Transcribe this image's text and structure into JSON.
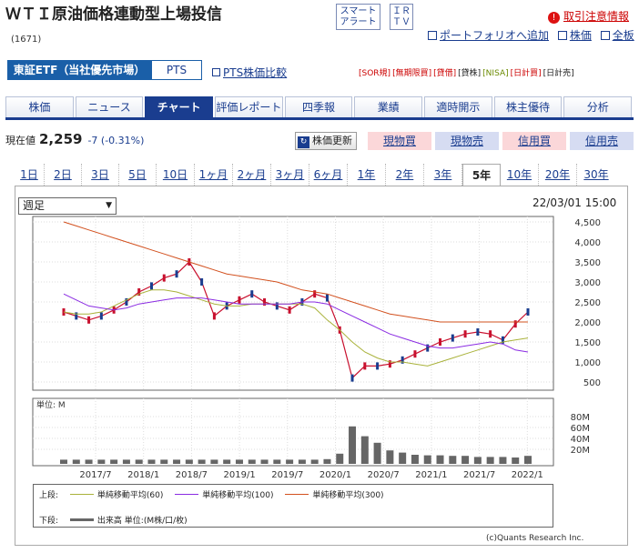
{
  "header": {
    "title": "ＷＴＩ原油価格連動型上場投信",
    "code": "(1671)",
    "smart_alert": "スマート アラート",
    "irtv": "ＩＲ ＴＶ",
    "warning": "取引注意情報",
    "links": [
      "ポートフォリオへ追加",
      "株価",
      "全板"
    ]
  },
  "market": {
    "active": "東証ETF（当社優先市場）",
    "pts": "PTS",
    "pts_compare": "PTS株価比較",
    "tags": [
      "[SOR規]",
      "[無期限買]",
      "[貸借]",
      "[貸株]",
      "[NISA]",
      "[日計買]",
      "[日計売]"
    ]
  },
  "tabs": [
    "株価",
    "ニュース",
    "チャート",
    "評価レポート",
    "四季報",
    "業績",
    "適時開示",
    "株主優待",
    "分析"
  ],
  "active_tab": "チャート",
  "price": {
    "label": "現在値",
    "value": "2,259",
    "change": "-7 (-0.31%)",
    "refresh": "株価更新"
  },
  "trade_buttons": [
    "現物買",
    "現物売",
    "信用買",
    "信用売"
  ],
  "periods": [
    "1日",
    "2日",
    "3日",
    "5日",
    "10日",
    "1ヶ月",
    "2ヶ月",
    "3ヶ月",
    "6ヶ月",
    "1年",
    "2年",
    "3年",
    "5年",
    "10年",
    "20年",
    "30年"
  ],
  "active_period": "5年",
  "chart_controls": {
    "interval": "週足",
    "datetime": "22/03/01 15:00"
  },
  "chart_data": [
    {
      "type": "line",
      "x_ticks": [
        "2017/7",
        "2018/1",
        "2018/7",
        "2019/1",
        "2019/7",
        "2020/1",
        "2020/7",
        "2021/1",
        "2021/7",
        "2022/1"
      ],
      "y_ticks": [
        "500",
        "1,000",
        "1,500",
        "2,000",
        "2,500",
        "3,000",
        "3,500",
        "4,000",
        "4,500"
      ],
      "ylim": [
        500,
        4500
      ],
      "grid": true,
      "series": [
        {
          "name": "株価",
          "color": "#c8102e",
          "values": [
            2250,
            2150,
            2050,
            2150,
            2300,
            2500,
            2750,
            2900,
            3100,
            3200,
            3500,
            3000,
            2150,
            2400,
            2550,
            2700,
            2500,
            2400,
            2300,
            2500,
            2700,
            2600,
            1800,
            600,
            900,
            900,
            950,
            1050,
            1200,
            1350,
            1500,
            1600,
            1700,
            1750,
            1700,
            1550,
            1950,
            2250
          ]
        },
        {
          "name": "単純移動平均(60)",
          "color": "#a9b23a",
          "values": [
            2250,
            2200,
            2200,
            2250,
            2400,
            2550,
            2700,
            2800,
            2800,
            2750,
            2650,
            2550,
            2450,
            2400,
            2400,
            2450,
            2450,
            2450,
            2450,
            2450,
            2350,
            2050,
            1800,
            1500,
            1250,
            1100,
            1000,
            1000,
            950,
            900,
            1000,
            1100,
            1200,
            1300,
            1400,
            1500,
            1550,
            1600
          ]
        },
        {
          "name": "単純移動平均(100)",
          "color": "#8a2be2",
          "values": [
            2700,
            2550,
            2400,
            2350,
            2300,
            2350,
            2450,
            2500,
            2550,
            2600,
            2600,
            2600,
            2550,
            2500,
            2450,
            2450,
            2450,
            2450,
            2450,
            2500,
            2500,
            2450,
            2300,
            2150,
            2000,
            1850,
            1700,
            1600,
            1500,
            1400,
            1350,
            1350,
            1400,
            1450,
            1500,
            1450,
            1300,
            1250
          ]
        },
        {
          "name": "単純移動平均(300)",
          "color": "#d2501e",
          "values": [
            4500,
            4400,
            4300,
            4200,
            4100,
            4000,
            3900,
            3800,
            3700,
            3600,
            3500,
            3400,
            3300,
            3200,
            3150,
            3100,
            3050,
            3000,
            2900,
            2800,
            2750,
            2700,
            2600,
            2500,
            2400,
            2300,
            2200,
            2150,
            2100,
            2050,
            2000,
            2000,
            2000,
            2000,
            2000,
            2000,
            2000,
            2000
          ]
        }
      ]
    },
    {
      "type": "bar",
      "y_ticks": [
        "20M",
        "40M",
        "60M",
        "80M"
      ],
      "ylim": [
        0,
        90
      ],
      "unit": "単位: M",
      "series": [
        {
          "name": "出来高",
          "color": "#666666",
          "values": [
            1,
            1,
            1,
            1,
            1,
            1,
            1,
            1,
            1,
            1,
            1,
            1,
            1,
            1,
            1,
            1,
            1,
            1,
            1,
            1,
            1,
            2,
            12,
            62,
            44,
            32,
            18,
            14,
            10,
            9,
            9,
            8,
            8,
            6,
            6,
            6,
            5,
            8
          ]
        }
      ]
    }
  ],
  "legend": {
    "upper_label": "上段:",
    "upper": [
      "単純移動平均(60)",
      "単純移動平均(100)",
      "単純移動平均(300)"
    ],
    "lower_label": "下段:",
    "lower": "出来高 単位:(M株/口/枚)"
  },
  "copyright": "(c)Quants Research Inc."
}
